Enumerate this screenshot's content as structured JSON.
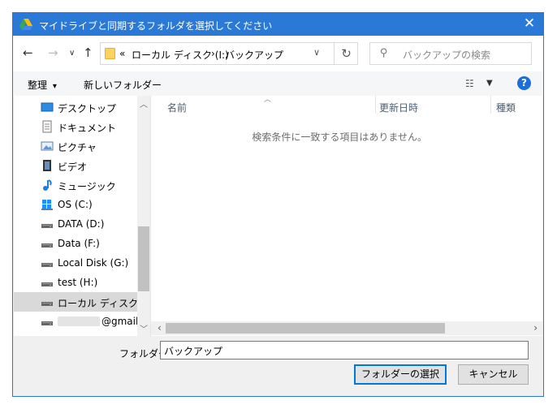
{
  "window": {
    "title": "マイドライブと同期するフォルダを選択してください"
  },
  "nav": {
    "back": "←",
    "forward": "→",
    "recent": "∨",
    "up": "↑"
  },
  "address": {
    "chevron": "«",
    "segment1": "ローカル ディスク (I:)",
    "separator": "›",
    "segment2": "バックアップ",
    "dropdown": "∨",
    "refresh": "↻"
  },
  "search": {
    "placeholder": "バックアップの検索"
  },
  "toolbar": {
    "organize_label": "整理",
    "organize_arrow": "▾",
    "new_folder_label": "新しいフォルダー",
    "help": "?"
  },
  "sidebar": {
    "items": [
      {
        "label": "デスクトップ",
        "icon": "desktop-icon"
      },
      {
        "label": "ドキュメント",
        "icon": "document-icon"
      },
      {
        "label": "ピクチャ",
        "icon": "pictures-icon"
      },
      {
        "label": "ビデオ",
        "icon": "video-icon"
      },
      {
        "label": "ミュージック",
        "icon": "music-icon"
      },
      {
        "label": "OS (C:)",
        "icon": "windows-drive-icon"
      },
      {
        "label": "DATA (D:)",
        "icon": "drive-icon"
      },
      {
        "label": "Data (F:)",
        "icon": "drive-icon"
      },
      {
        "label": "Local Disk (G:)",
        "icon": "drive-icon"
      },
      {
        "label": "test (H:)",
        "icon": "drive-icon"
      },
      {
        "label": "ローカル ディスク (I:)",
        "icon": "drive-icon",
        "selected": true
      },
      {
        "label": "@gmail.com",
        "icon": "drive-icon"
      }
    ]
  },
  "file_list": {
    "columns": [
      "名前",
      "更新日時",
      "種類"
    ],
    "empty_message": "検索条件に一致する項目はありません。"
  },
  "footer": {
    "folder_label": "フォルダー:",
    "folder_value": "バックアップ",
    "select_button": "フォルダーの選択",
    "cancel_button": "キャンセル"
  },
  "colors": {
    "title_bar": "#2b79d7",
    "folder_yellow": "#ffd25e",
    "selected_item": "#d9d9d9"
  }
}
